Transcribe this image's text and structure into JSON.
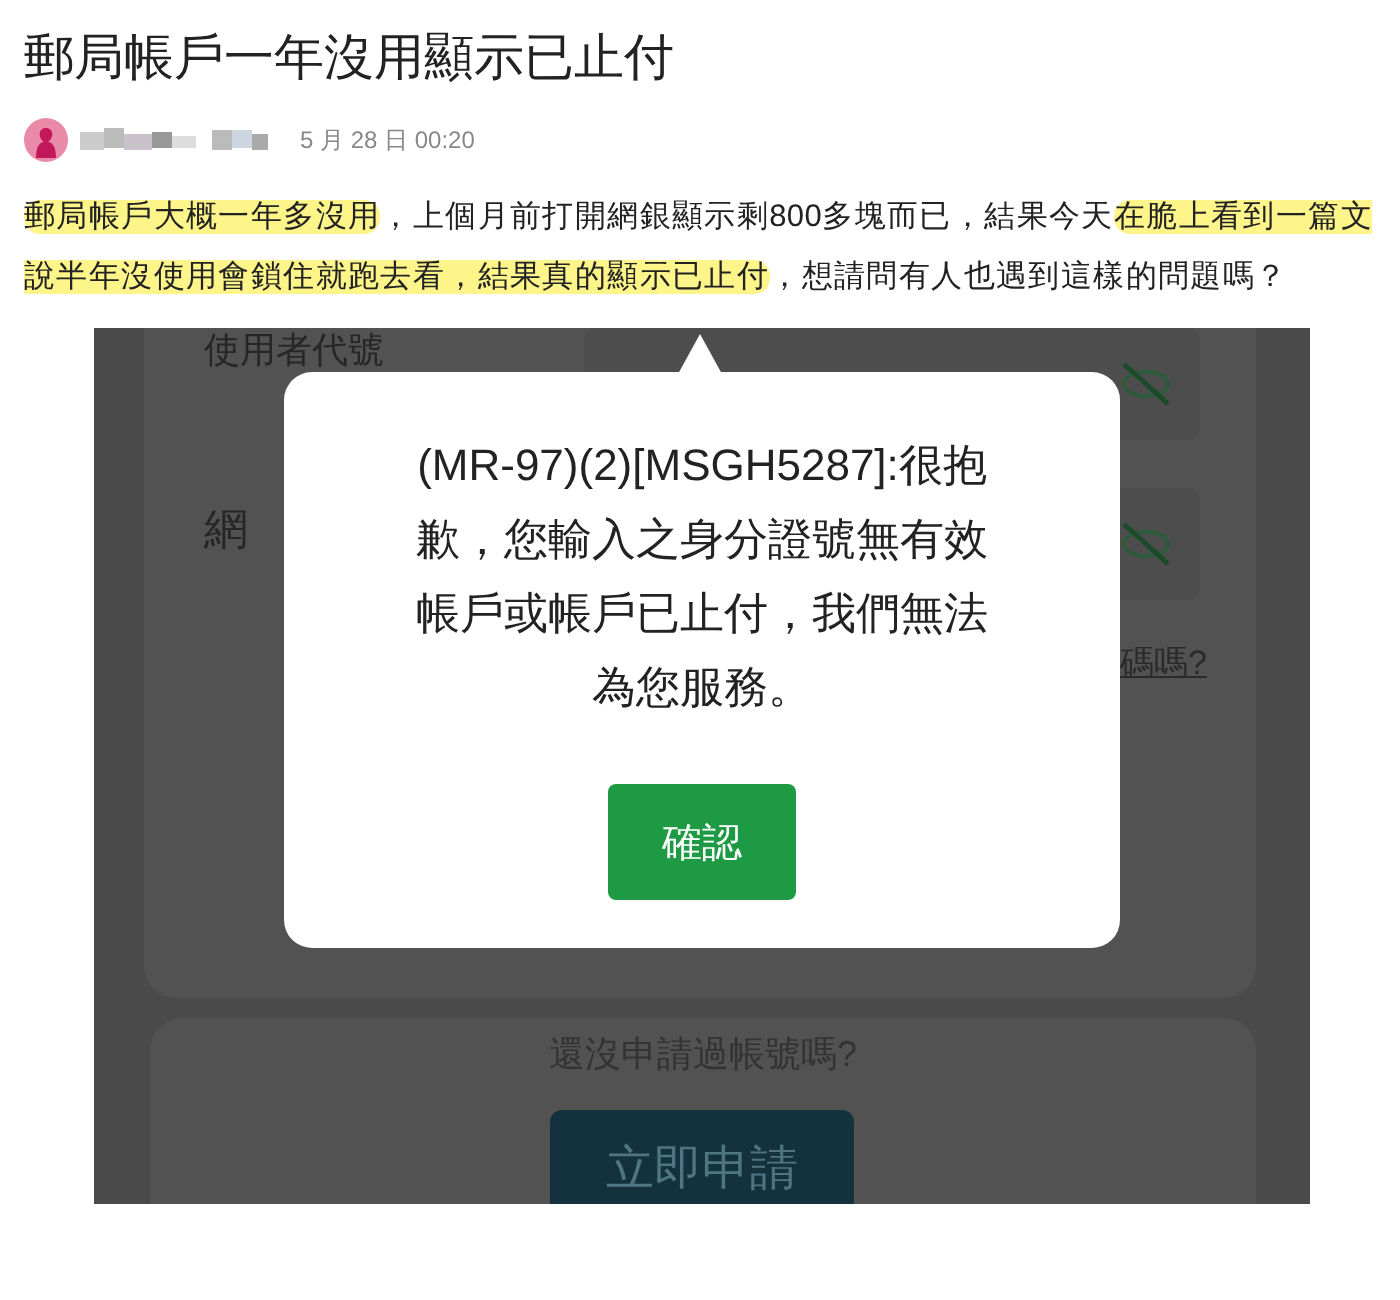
{
  "post": {
    "title": "郵局帳戶一年沒用顯示已止付",
    "date": "5 月 28 日 00:20",
    "paragraph": [
      {
        "text": "郵局帳戶大概一年多沒用",
        "highlight": true
      },
      {
        "text": "，上個月前打開網銀顯示剩800多塊而已，結果今天",
        "highlight": false
      },
      {
        "text": "在脆上看到一篇文說半年沒使用會鎖住就跑去看，結果真的顯示已止付",
        "highlight": true
      },
      {
        "text": "，想請問有人也遇到這樣的問題嗎？",
        "highlight": false
      }
    ]
  },
  "screenshot": {
    "field_labels": [
      "使用者代號",
      "網"
    ],
    "link": "碼嗎?",
    "signup_prompt": "還沒申請過帳號嗎?",
    "signup_button": "立即申請",
    "dialog": {
      "message": "(MR-97)(2)[MSGH5287]:很抱歉，您輸入之身分證號無有效帳戶或帳戶已止付，我們無法為您服務。",
      "button": "確認"
    }
  }
}
